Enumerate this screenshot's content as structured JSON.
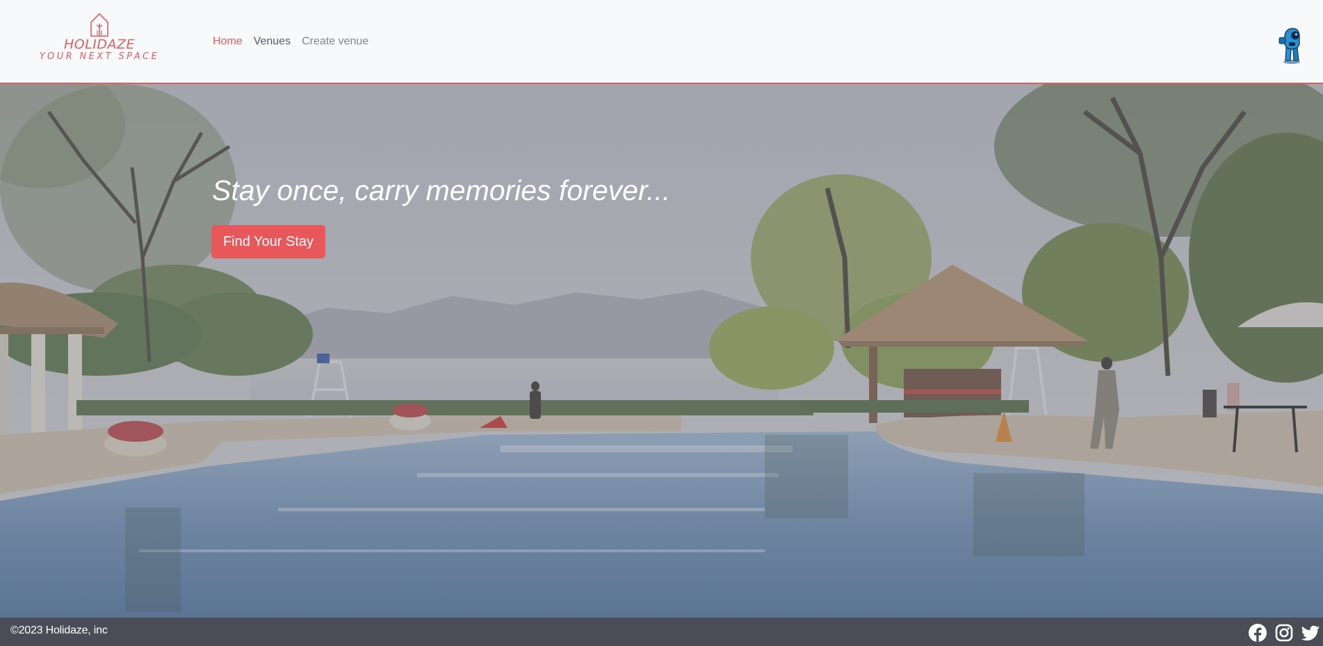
{
  "brand": {
    "name": "HOLIDAZE",
    "tagline": "YOUR NEXT SPACE",
    "accent_color": "#e35b5b"
  },
  "nav": {
    "items": [
      {
        "label": "Home",
        "state": "active"
      },
      {
        "label": "Venues",
        "state": "default"
      },
      {
        "label": "Create venue",
        "state": "default"
      }
    ]
  },
  "header": {
    "avatar_icon": "robot-avatar-icon"
  },
  "hero": {
    "headline": "Stay once, carry memories forever...",
    "cta_label": "Find Your Stay",
    "cta_color": "#e8575a",
    "background_icon": "resort-pool-photo"
  },
  "footer": {
    "copyright": "©2023 Holidaze, inc",
    "social_icons": [
      "facebook-icon",
      "instagram-icon",
      "twitter-icon"
    ],
    "background_color": "#4a4d55"
  }
}
